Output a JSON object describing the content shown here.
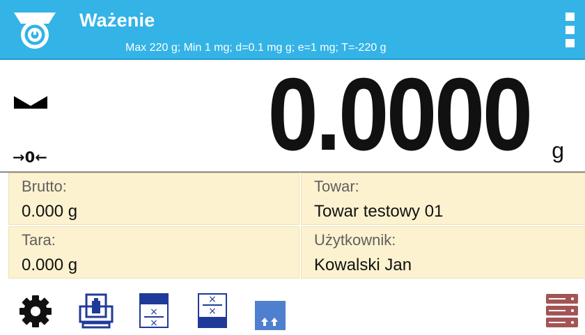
{
  "header": {
    "title": "Ważenie",
    "subtitle": "Max 220 g; Min 1 mg; d=0.1 mg g; e=1 mg; T=-220 g",
    "logo_icon": "scale-icon",
    "menu_icon": "vertical-dots-menu-icon"
  },
  "weighing": {
    "value": "0.0000",
    "unit": "g",
    "stable_icon": "stability-marker-icon",
    "zero_indicator": "→0←"
  },
  "info": {
    "brutto_label": "Brutto:",
    "brutto_value": "0.000 g",
    "towar_label": "Towar:",
    "towar_value": "Towar testowy 01",
    "tara_label": "Tara:",
    "tara_value": "0.000 g",
    "user_label": "Użytkownik:",
    "user_value": "Kowalski Jan"
  },
  "toolbar": {
    "buttons": [
      "settings-gear-icon",
      "tare-icon",
      "x-x-bottom-icon",
      "x-x-top-icon",
      "up-arrows-icon",
      "database-icon"
    ]
  },
  "colors": {
    "header": "#33b3e6",
    "info_bg": "#fdf2cf",
    "toolbar_blue": "#1f3a99",
    "database_red": "#a35555"
  }
}
